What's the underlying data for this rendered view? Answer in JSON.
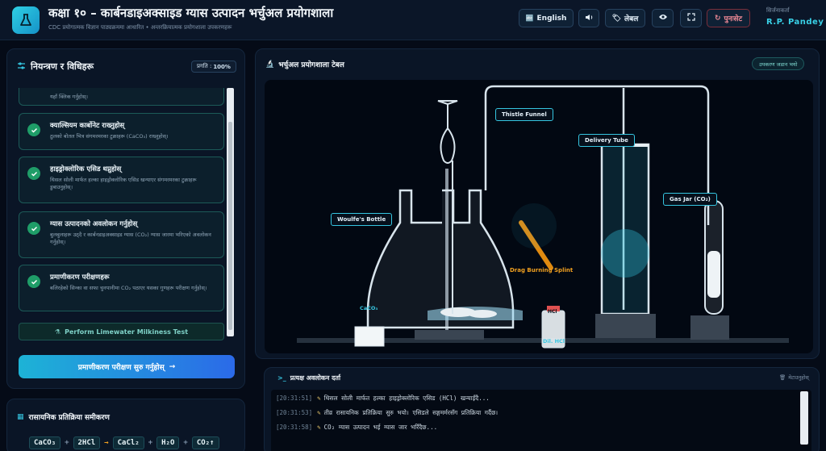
{
  "header": {
    "title": "कक्षा १० – कार्बनडाइअक्साइड ग्यास उत्पादन भर्चुअल प्रयोगशाला",
    "subtitle": "CDC प्रयोगात्मक विज्ञान पाठ्यक्रममा आधारित • अन्तरक्रियात्मक प्रयोगशाला उपकरणहरू",
    "buttons": {
      "language": "English",
      "label": "लेबल",
      "reset": "पुनःसेट"
    },
    "author_label": "सिर्जनाकर्ता",
    "author_name": "R.P. Pandey"
  },
  "left_panel": {
    "title": "नियन्त्रण र विधिहरू",
    "progress_label": "प्रगति :",
    "progress_value": "100%",
    "steps": [
      {
        "title": "",
        "desc": "यहाँ क्लिक गर्नुहोस्।"
      },
      {
        "title": "क्याल्सियम कार्बोनेट राख्नुहोस्",
        "desc": "ठुलको बोतल भित्र संगमरमरका टुक्राहरू (CaCO₃) राख्नुहोस्।"
      },
      {
        "title": "हाइड्रोक्लोरिक एसिड थप्नुहोस्",
        "desc": "थिसल सोली मार्फत हल्का हाइड्रोक्लोरिक एसिड खन्याएर संगमरमरका टुक्राहरू डुबाउनुहोस्।"
      },
      {
        "title": "ग्यास उत्पादनको अवलोकन गर्नुहोस्",
        "desc": "बुलबुलाहरू उठ्दै र कार्बनडाइअक्साइड ग्यास (CO₂) ग्यास जारमा भरिएको अवलोकन गर्नुहोस्।"
      },
      {
        "title": "प्रमाणीकरण परीक्षणहरू",
        "desc": "बलिरहेको सिन्का वा सफा चुनपानीमा CO₂ पठाएर यसका गुणहरू परीक्षण गर्नुहोस्।"
      }
    ],
    "limewater_button": "Perform Limewater Milkiness Test",
    "start_button": "प्रमाणीकरण परीक्षण सुरु गर्नुहोस्"
  },
  "equation_panel": {
    "title": "रासायनिक प्रतिक्रिया समीकरण",
    "terms": [
      "CaCO₃",
      "+",
      "2HCl",
      "→",
      "CaCl₂",
      "+",
      "H₂O",
      "+",
      "CO₂↑"
    ]
  },
  "lab": {
    "title": "भर्चुअल प्रयोगशाला टेबल",
    "badge": "उपकरण जडान भयो",
    "labels": {
      "thistle_funnel": "Thistle Funnel",
      "delivery_tube": "Delivery Tube",
      "woulfe_bottle": "Woulfe's Bottle",
      "gas_jar": "Gas Jar (CO₂)",
      "splint": "Drag Burning Splint",
      "caco3": "CaCO₃",
      "hcl_bottle": "HCl",
      "hcl_caption": "Dil. HCl"
    }
  },
  "log": {
    "title": "प्रत्यक्ष अवलोकन दर्ता",
    "clear_label": "मेटाउनुहोस्",
    "entries": [
      {
        "time": "[20:31:51]",
        "text": "थिसल सोली मार्फत हल्का हाइड्रोक्लोरिक एसिड (HCl) खन्याइँदै..."
      },
      {
        "time": "[20:31:53]",
        "text": "तीव्र रासायनिक प्रतिक्रिया सुरु भयो। एसिडले सङ्गमर्मरसँग प्रतिक्रिया गर्दैछ।"
      },
      {
        "time": "[20:31:58]",
        "text": "CO₂ ग्यास उत्पादन भई ग्यास जार भरिँदैछ..."
      }
    ]
  },
  "colors": {
    "accent": "#35c5e0",
    "success": "#1f9d68",
    "reset": "#f08a97",
    "splint": "#e08a10"
  },
  "icons": [
    "flask-icon",
    "language-icon",
    "speaker-icon",
    "tag-icon",
    "eye-icon",
    "fullscreen-icon",
    "reset-icon",
    "sliders-icon",
    "microscope-icon",
    "check-icon",
    "terminal-icon",
    "trash-icon",
    "flask-small-icon",
    "arrow-right-icon"
  ]
}
